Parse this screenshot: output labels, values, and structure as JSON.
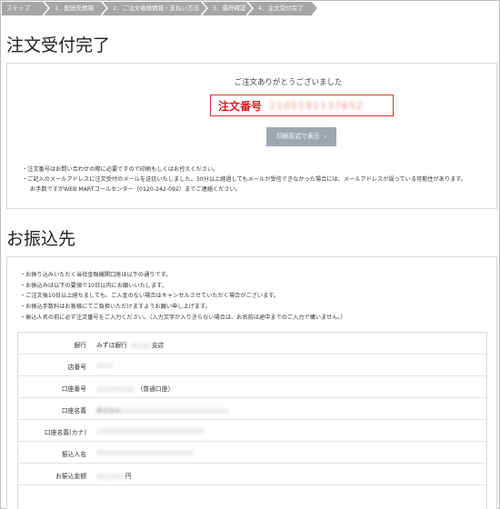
{
  "steps": [
    "ステップ",
    "1．配送先情報",
    "2．ご注文者様情報・支払い方法",
    "3．最終確認",
    "4．注文受付完了"
  ],
  "page_title": "注文受付完了",
  "thanks": "ご注文ありがとうございました",
  "order": {
    "label": "注文番号",
    "number": "2105191137652"
  },
  "print_button": "印刷形式で表示",
  "notes1": [
    "・注文番号はお問い合わせの際に必要ですので印刷もしくはお控えください。",
    "・ご記入のメールアドレスに注文受付のメールを送信いたしました。30分以上経過してもメールが受信できなかった場合には、メールアドレスが誤っている可能性があります。",
    "お手数ですがWEB MARTコールセンター（0120-242-092）までご連絡ください。"
  ],
  "section_title": "お振込先",
  "notes2": [
    "・お振り込みいただく当社金融機関口座は以下の通りです。",
    "・お振込みは以下の要領で10日以内にお願いいたします。",
    "・ご注文後10日以上経ちましても、ご入金のない場合はキャンセルさせていただく場合がございます。",
    "・お振込手数料はお客様にてご負担いただけますようお願い申し上げます。",
    "・振込人名の前に必ず注文番号をご入力ください。（入力文字が入りきらない場合は、お名前は途中までのご入力で構いません。）"
  ],
  "bank_rows": [
    {
      "label": "銀行",
      "value": "みずほ銀行",
      "blurred": "○○○○",
      "suffix": "支店"
    },
    {
      "label": "店番号",
      "value": "",
      "blurred": "○○○",
      "suffix": ""
    },
    {
      "label": "口座番号",
      "value": "",
      "blurred": "○○○○○○○",
      "suffix": "（普通口座）"
    },
    {
      "label": "口座名義",
      "value": "",
      "blurred": "株式会社○○○○○○○○○○○○○○○○○○○○",
      "suffix": ""
    },
    {
      "label": "口座名義(カナ)",
      "value": "",
      "blurred": "○○○○○○○○○○○○○○○○○○○○",
      "suffix": ""
    },
    {
      "label": "振込人名",
      "value": "",
      "blurred": "○○○○○○○○○○○○○○○○○○",
      "suffix": ""
    },
    {
      "label": "お振込金額",
      "value": "",
      "blurred": "○○,○○○",
      "suffix": "円"
    }
  ]
}
